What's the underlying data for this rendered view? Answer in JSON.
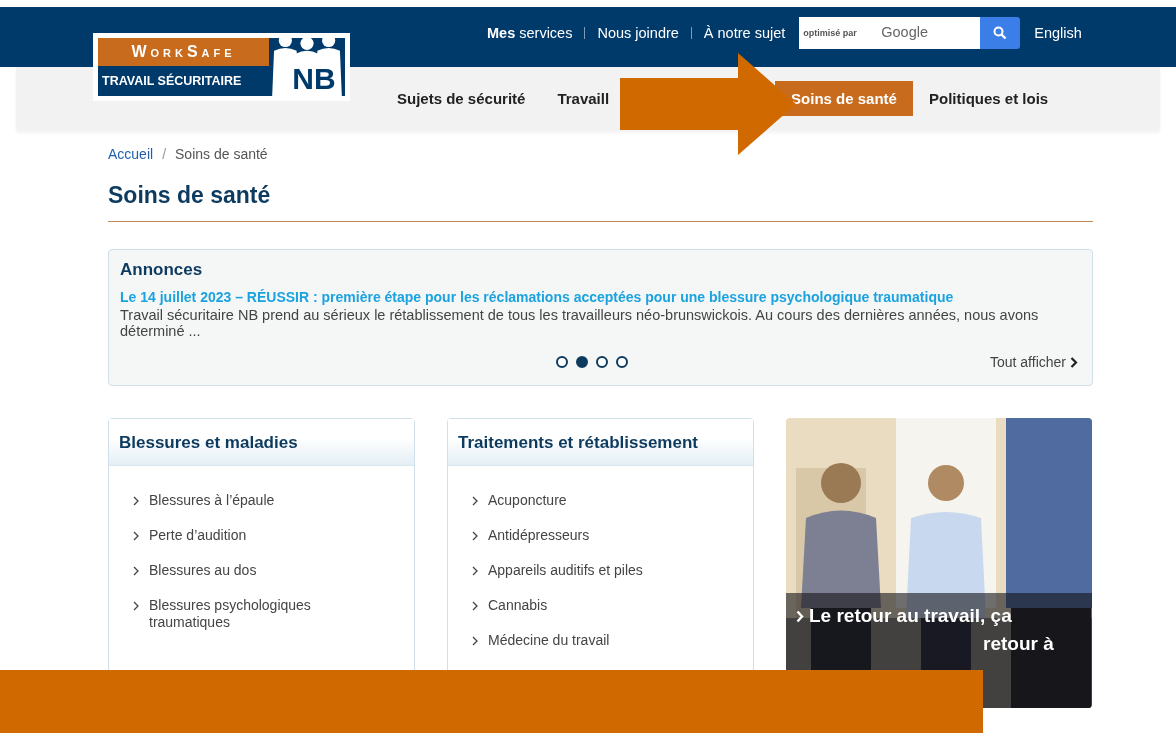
{
  "logo": {
    "top": "WorkSafe",
    "bottom": "TRAVAIL SÉCURITAIRE",
    "mark": "NB"
  },
  "top_links": [
    {
      "bold": "Mes",
      "text": "services"
    },
    {
      "text": "Nous joindre"
    },
    {
      "text": "À notre sujet"
    }
  ],
  "search": {
    "placeholder": "optimisé par",
    "brand": "Google"
  },
  "language_link": "English",
  "nav": [
    {
      "label": "Sujets de sécurité",
      "selected": false
    },
    {
      "label": "Travaill",
      "selected": false
    },
    {
      "label": "Soins de santé",
      "selected": true
    },
    {
      "label": "Politiques et lois",
      "selected": false
    }
  ],
  "breadcrumb": [
    "Accueil",
    "Soins de santé"
  ],
  "breadcrumb_separator": "/",
  "page_title": "Soins de santé",
  "announcements": {
    "title": "Annonces",
    "headline": "Le 14 juillet 2023 – RÉUSSIR : première étape pour les réclamations acceptées pour une blessure psychologique traumatique",
    "summary": "Travail sécuritaire NB prend au sérieux le rétablissement de tous les travailleurs néo-brunswickois. Au cours des dernières années, nous avons déterminé ...",
    "dots": [
      {
        "selected": false
      },
      {
        "selected": true
      },
      {
        "selected": false
      },
      {
        "selected": false
      }
    ],
    "view_all": "Tout afficher"
  },
  "cards": [
    {
      "title": "Blessures et maladies",
      "items": [
        "Blessures à l’épaule",
        "Perte d’audition",
        "Blessures au dos",
        "Blessures psychologiques traumatiques"
      ]
    },
    {
      "title": "Traitements et rétablissement",
      "items": [
        "Acuponcture",
        "Antidépresseurs",
        "Appareils auditifs et piles",
        "Cannabis",
        "Médecine du travail"
      ]
    }
  ],
  "feature": {
    "kind": "picture",
    "caption": "Le retour au travail, ça",
    "caption_rest": "retour à"
  }
}
